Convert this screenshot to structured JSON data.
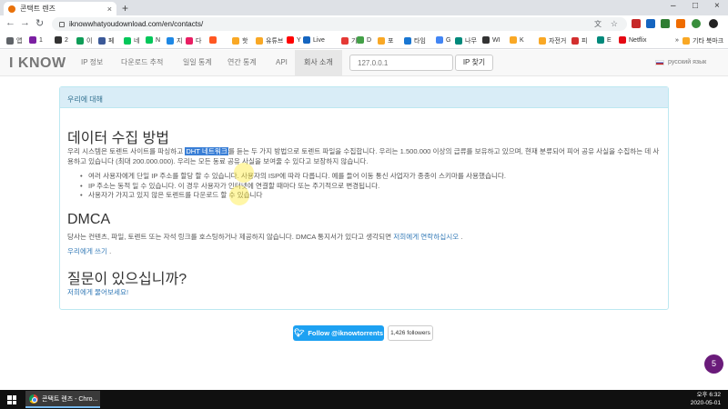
{
  "browser": {
    "tab_title": "콘택트 렌즈",
    "tab_close": "×",
    "new_tab": "+",
    "url": "iknowwhatyoudownload.com/en/contacts/",
    "window_controls": [
      "–",
      "□",
      "×"
    ],
    "nav_icons": [
      "back-arrow-icon",
      "forward-arrow-icon",
      "reload-icon"
    ]
  },
  "bookmarks": [
    {
      "label": "앱",
      "color": "#5f6368"
    },
    {
      "label": "1",
      "color": "#7b1fa2"
    },
    {
      "label": "2",
      "color": "#333333"
    },
    {
      "label": "이",
      "color": "#0f9d58"
    },
    {
      "label": "페",
      "color": "#3b5998"
    },
    {
      "label": "네",
      "color": "#03c75a"
    },
    {
      "label": "N",
      "color": "#03c75a"
    },
    {
      "label": "지",
      "color": "#1e88e5"
    },
    {
      "label": "다",
      "color": "#e91e63"
    },
    {
      "label": "",
      "color": "#ff5722"
    },
    {
      "label": "핫",
      "color": "#f9a825"
    },
    {
      "label": "유튜브",
      "color": "#f9a825"
    },
    {
      "label": "Y",
      "color": "#ff0000"
    },
    {
      "label": "Live",
      "color": "#1565c0"
    },
    {
      "label": "기",
      "color": "#e53935"
    },
    {
      "label": "D",
      "color": "#43a047"
    },
    {
      "label": "포",
      "color": "#f9a825"
    },
    {
      "label": "타임",
      "color": "#1976d2"
    },
    {
      "label": "G",
      "color": "#4285f4"
    },
    {
      "label": "나무",
      "color": "#00897b"
    },
    {
      "label": "WI",
      "color": "#333333"
    },
    {
      "label": "K",
      "color": "#f9a825"
    },
    {
      "label": "자전거",
      "color": "#f9a825"
    },
    {
      "label": "피",
      "color": "#d32f2f"
    },
    {
      "label": "E",
      "color": "#00897b"
    },
    {
      "label": "Netflix",
      "color": "#e50914"
    },
    {
      "label": "»",
      "color": "transparent"
    },
    {
      "label": "기타 북마크",
      "color": "#f9a825"
    }
  ],
  "site": {
    "logo": "I KNOW",
    "nav": [
      "IP 정보",
      "다운로드 추적",
      "일일 통계",
      "연간 통계",
      "API"
    ],
    "nav_active": "회사 소개",
    "ip_placeholder": "127.0.0.1",
    "ip_button": "IP 찾기",
    "language": "русский язык"
  },
  "panel": {
    "header": "우리에 대해",
    "section1_title": "데이터 수집 방법",
    "intro_before": "우리 시스템은 토렌트 사이트를 파싱하고 ",
    "intro_highlight": "DHT 네트워크",
    "intro_after": "를 듣는 두 가지 방법으로 토렌트 파일을 수집합니다. 우리는 1.500.000 이상의 급류를 보유하고 있으며, 현재 분류되어 피어 공유 사실을 수집하는 데 사용하고 있습니다 (최대 200.000.000). 우리는 모든 동료 공유 사실을 보여줄 수 있다고 보장하지 않습니다.",
    "bullets": [
      "여러 사용자에게 단일 IP 주소를 할당 할 수 있습니다. 사용자의 ISP에 따라 다릅니다. 예를 들어 이동 통신 사업자가 종종이 스키마를 사용했습니다.",
      "IP 주소는 동적 일 수 있습니다. 이 경우 사용자가 인터넷에 연결할 때마다 또는 주기적으로 변경됩니다.",
      "사용자가 가지고 있지 않은 토렌트를 다운로드 할 수 있습니다"
    ],
    "section2_title": "DMCA",
    "dmca_text": "당사는 컨텐츠, 파일, 토렌트 또는 자석 링크를 호스팅하거나 제공하지 않습니다. DMCA 통지서가 있다고 생각되면",
    "dmca_link": "저희에게 연락하십시오",
    "dmca_end": ".",
    "write_link": "우리에게 쓰기",
    "write_end": ".",
    "section3_title": "질문이 있으십니까?",
    "ask_link": "저희에게 물어보세요!"
  },
  "social": {
    "follow_label": "Follow @iknowtorrents",
    "followers": "1,426 followers"
  },
  "badge": "5",
  "taskbar": {
    "item_label": "콘택트 렌즈 - Chro...",
    "time": "오후 6:32",
    "date": "2020-05-01"
  },
  "colors": {
    "panel_header_bg": "#d9edf7",
    "link": "#337ab7",
    "highlight": "#3a7fd6",
    "twitter": "#1da1f2",
    "badge": "#6a1b7a"
  }
}
